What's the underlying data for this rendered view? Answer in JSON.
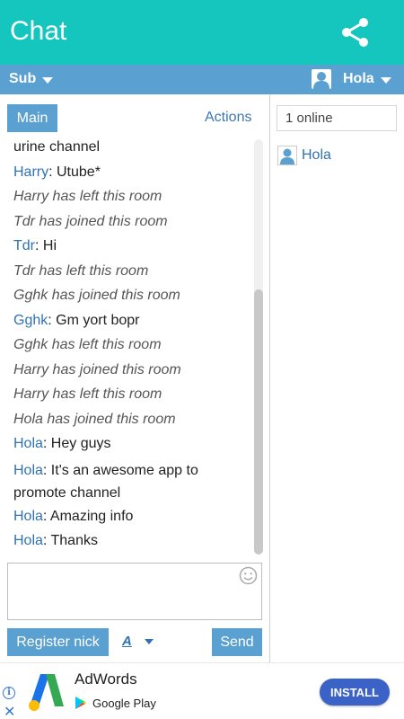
{
  "appbar": {
    "title": "Chat",
    "share_icon": "share-icon",
    "color": "#15c6bf"
  },
  "subbar": {
    "room": "Sub",
    "user": "Hola",
    "color": "#5aa0d0"
  },
  "tabs": {
    "main": "Main",
    "actions": "Actions"
  },
  "messages": [
    {
      "type": "text",
      "nick": "",
      "text": "urine channel"
    },
    {
      "type": "chat",
      "nick": "Harry",
      "text": ": Utube*"
    },
    {
      "type": "sys",
      "text": "Harry has left this room"
    },
    {
      "type": "sys",
      "text": "Tdr has joined this room"
    },
    {
      "type": "chat",
      "nick": "Tdr",
      "text": ": Hi"
    },
    {
      "type": "sys",
      "text": "Tdr has left this room"
    },
    {
      "type": "sys",
      "text": "Gghk has joined this room"
    },
    {
      "type": "chat",
      "nick": "Gghk",
      "text": ": Gm yort bopr"
    },
    {
      "type": "sys",
      "text": "Gghk has left this room"
    },
    {
      "type": "sys",
      "text": "Harry has joined this room"
    },
    {
      "type": "sys",
      "text": "Harry has left this room"
    },
    {
      "type": "sys",
      "text": "Hola has joined this room"
    },
    {
      "type": "chat",
      "nick": "Hola",
      "text": ": Hey guys"
    },
    {
      "type": "chat",
      "nick": "Hola",
      "text": ": It's an awesome app to promote channel"
    },
    {
      "type": "chat",
      "nick": "Hola",
      "text": ": Amazing info"
    },
    {
      "type": "chat",
      "nick": "Hola",
      "text": ": Thanks"
    }
  ],
  "composer": {
    "value": "",
    "smiley_icon": "smiley-icon"
  },
  "buttons": {
    "register": "Register nick",
    "font": "A",
    "send": "Send"
  },
  "online": {
    "count_label": "1 online",
    "users": [
      "Hola"
    ]
  },
  "ad": {
    "title": "AdWords",
    "store": "Google Play",
    "install": "INSTALL",
    "install_color": "#3b63c7"
  }
}
